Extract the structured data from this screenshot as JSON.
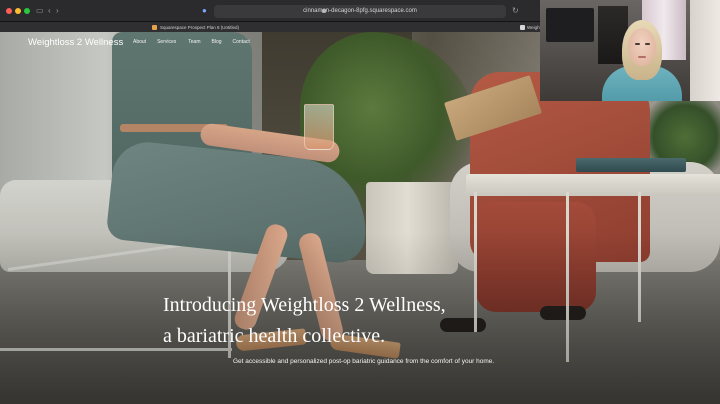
{
  "browser": {
    "url": "cinnamon-decagon-8pfg.squarespace.com",
    "tab_label": "Squarespace Prospect Plan 8 (Untitled)",
    "side_tab_label": "Weight"
  },
  "site": {
    "brand": "Weightloss 2 Wellness",
    "nav": [
      {
        "label": "About"
      },
      {
        "label": "Services"
      },
      {
        "label": "Team"
      },
      {
        "label": "Blog"
      },
      {
        "label": "Contact"
      }
    ],
    "headline_line1": "Introducing Weightloss 2 Wellness,",
    "headline_line2": "a bariatric health collective.",
    "subtext": "Get accessible and personalized post-op bariatric guidance from the comfort of your home."
  },
  "colors": {
    "traffic_red": "#ff5f57",
    "traffic_yellow": "#febc2e",
    "traffic_green": "#28c840",
    "hero_text": "#ffffff"
  }
}
